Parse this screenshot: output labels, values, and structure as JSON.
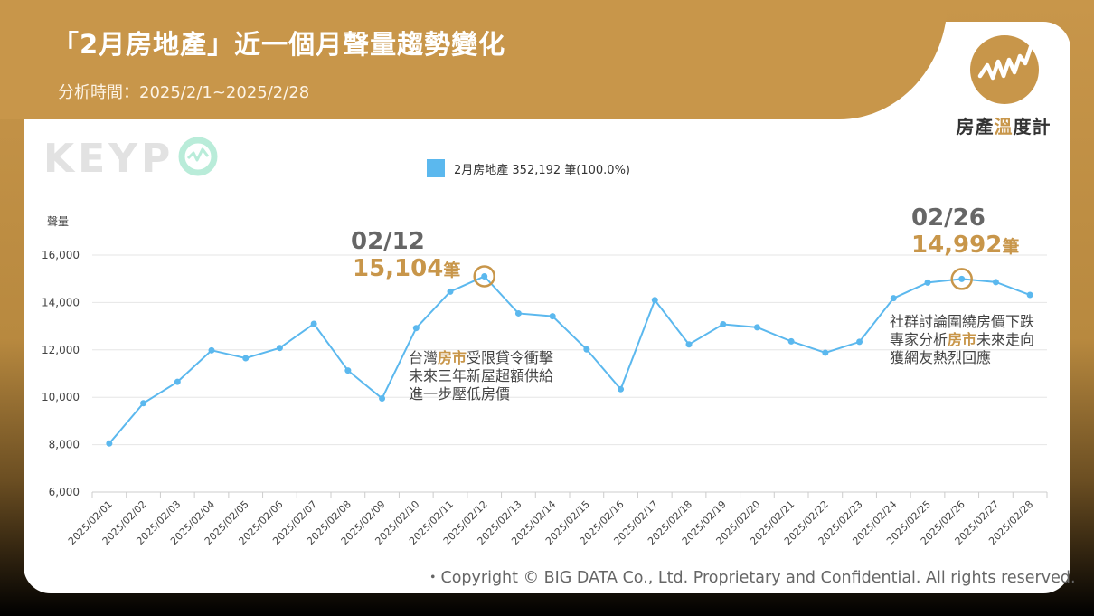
{
  "header": {
    "title": "「2月房地產」近一個月聲量趨勢變化",
    "subtitle": "分析時間：2025/2/1~2025/2/28"
  },
  "brand": {
    "name_part1": "房產",
    "name_part2": "溫",
    "name_part3": "度計",
    "icon": "trend-line-icon"
  },
  "watermark": {
    "text": "KEYP"
  },
  "colors": {
    "accent": "#c8964a",
    "series": "#5bb8ee"
  },
  "annotations": {
    "peak1": {
      "date": "02/12",
      "value": "15,104",
      "unit": "筆",
      "line1_a": "台灣",
      "line1_hl": "房市",
      "line1_b": "受限貸令衝擊",
      "line2": "未來三年新屋超額供給",
      "line3": "進一步壓低房價"
    },
    "peak2": {
      "date": "02/26",
      "value": "14,992",
      "unit": "筆",
      "line1": "社群討論圍繞房價下跌",
      "line2_a": "專家分析",
      "line2_hl": "房市",
      "line2_b": "未來走向",
      "line3": "獲網友熱烈回應"
    }
  },
  "footer": {
    "copyright": "・Copyright © BIG DATA Co., Ltd. Proprietary and Confidential. All rights reserved."
  },
  "chart_data": {
    "type": "line",
    "ylabel": "聲量",
    "xlabel": "",
    "ylim": [
      6000,
      16000
    ],
    "yticks": [
      "6,000",
      "8,000",
      "10,000",
      "12,000",
      "14,000",
      "16,000"
    ],
    "grid": true,
    "legend": "top-center",
    "legend_label": "2月房地產 352,192 筆(100.0%)",
    "categories": [
      "2025/02/01",
      "2025/02/02",
      "2025/02/03",
      "2025/02/04",
      "2025/02/05",
      "2025/02/06",
      "2025/02/07",
      "2025/02/08",
      "2025/02/09",
      "2025/02/10",
      "2025/02/11",
      "2025/02/12",
      "2025/02/13",
      "2025/02/14",
      "2025/02/15",
      "2025/02/16",
      "2025/02/17",
      "2025/02/18",
      "2025/02/19",
      "2025/02/20",
      "2025/02/21",
      "2025/02/22",
      "2025/02/23",
      "2025/02/24",
      "2025/02/25",
      "2025/02/26",
      "2025/02/27",
      "2025/02/28"
    ],
    "series": [
      {
        "name": "2月房地產",
        "values": [
          8050,
          9750,
          10650,
          11980,
          11650,
          12080,
          13100,
          11130,
          9950,
          12920,
          14460,
          15104,
          13540,
          13420,
          12020,
          10340,
          14100,
          12230,
          13080,
          12950,
          12360,
          11880,
          12340,
          14180,
          14840,
          14992,
          14860,
          14320
        ]
      }
    ],
    "highlights": [
      {
        "x": "2025/02/12",
        "y": 15104
      },
      {
        "x": "2025/02/26",
        "y": 14992
      }
    ]
  }
}
